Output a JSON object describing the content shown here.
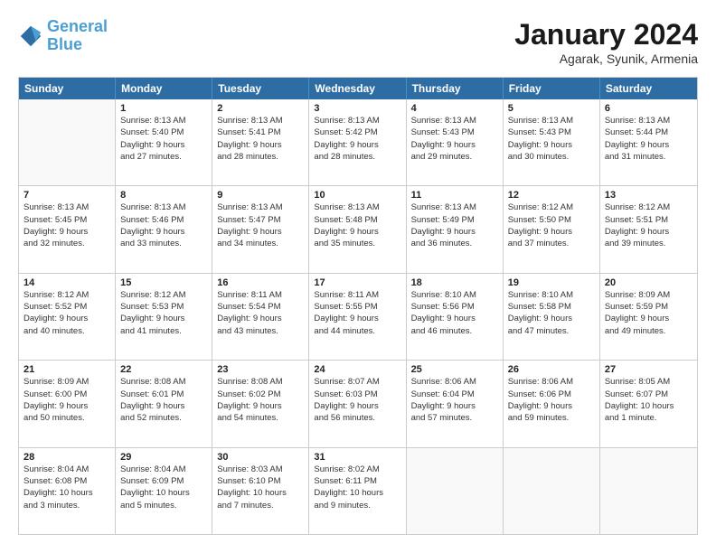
{
  "header": {
    "logo": {
      "line1": "General",
      "line2": "Blue"
    },
    "title": "January 2024",
    "location": "Agarak, Syunik, Armenia"
  },
  "weekdays": [
    "Sunday",
    "Monday",
    "Tuesday",
    "Wednesday",
    "Thursday",
    "Friday",
    "Saturday"
  ],
  "rows": [
    [
      {
        "day": "",
        "info": ""
      },
      {
        "day": "1",
        "info": "Sunrise: 8:13 AM\nSunset: 5:40 PM\nDaylight: 9 hours\nand 27 minutes."
      },
      {
        "day": "2",
        "info": "Sunrise: 8:13 AM\nSunset: 5:41 PM\nDaylight: 9 hours\nand 28 minutes."
      },
      {
        "day": "3",
        "info": "Sunrise: 8:13 AM\nSunset: 5:42 PM\nDaylight: 9 hours\nand 28 minutes."
      },
      {
        "day": "4",
        "info": "Sunrise: 8:13 AM\nSunset: 5:43 PM\nDaylight: 9 hours\nand 29 minutes."
      },
      {
        "day": "5",
        "info": "Sunrise: 8:13 AM\nSunset: 5:43 PM\nDaylight: 9 hours\nand 30 minutes."
      },
      {
        "day": "6",
        "info": "Sunrise: 8:13 AM\nSunset: 5:44 PM\nDaylight: 9 hours\nand 31 minutes."
      }
    ],
    [
      {
        "day": "7",
        "info": "Sunrise: 8:13 AM\nSunset: 5:45 PM\nDaylight: 9 hours\nand 32 minutes."
      },
      {
        "day": "8",
        "info": "Sunrise: 8:13 AM\nSunset: 5:46 PM\nDaylight: 9 hours\nand 33 minutes."
      },
      {
        "day": "9",
        "info": "Sunrise: 8:13 AM\nSunset: 5:47 PM\nDaylight: 9 hours\nand 34 minutes."
      },
      {
        "day": "10",
        "info": "Sunrise: 8:13 AM\nSunset: 5:48 PM\nDaylight: 9 hours\nand 35 minutes."
      },
      {
        "day": "11",
        "info": "Sunrise: 8:13 AM\nSunset: 5:49 PM\nDaylight: 9 hours\nand 36 minutes."
      },
      {
        "day": "12",
        "info": "Sunrise: 8:12 AM\nSunset: 5:50 PM\nDaylight: 9 hours\nand 37 minutes."
      },
      {
        "day": "13",
        "info": "Sunrise: 8:12 AM\nSunset: 5:51 PM\nDaylight: 9 hours\nand 39 minutes."
      }
    ],
    [
      {
        "day": "14",
        "info": "Sunrise: 8:12 AM\nSunset: 5:52 PM\nDaylight: 9 hours\nand 40 minutes."
      },
      {
        "day": "15",
        "info": "Sunrise: 8:12 AM\nSunset: 5:53 PM\nDaylight: 9 hours\nand 41 minutes."
      },
      {
        "day": "16",
        "info": "Sunrise: 8:11 AM\nSunset: 5:54 PM\nDaylight: 9 hours\nand 43 minutes."
      },
      {
        "day": "17",
        "info": "Sunrise: 8:11 AM\nSunset: 5:55 PM\nDaylight: 9 hours\nand 44 minutes."
      },
      {
        "day": "18",
        "info": "Sunrise: 8:10 AM\nSunset: 5:56 PM\nDaylight: 9 hours\nand 46 minutes."
      },
      {
        "day": "19",
        "info": "Sunrise: 8:10 AM\nSunset: 5:58 PM\nDaylight: 9 hours\nand 47 minutes."
      },
      {
        "day": "20",
        "info": "Sunrise: 8:09 AM\nSunset: 5:59 PM\nDaylight: 9 hours\nand 49 minutes."
      }
    ],
    [
      {
        "day": "21",
        "info": "Sunrise: 8:09 AM\nSunset: 6:00 PM\nDaylight: 9 hours\nand 50 minutes."
      },
      {
        "day": "22",
        "info": "Sunrise: 8:08 AM\nSunset: 6:01 PM\nDaylight: 9 hours\nand 52 minutes."
      },
      {
        "day": "23",
        "info": "Sunrise: 8:08 AM\nSunset: 6:02 PM\nDaylight: 9 hours\nand 54 minutes."
      },
      {
        "day": "24",
        "info": "Sunrise: 8:07 AM\nSunset: 6:03 PM\nDaylight: 9 hours\nand 56 minutes."
      },
      {
        "day": "25",
        "info": "Sunrise: 8:06 AM\nSunset: 6:04 PM\nDaylight: 9 hours\nand 57 minutes."
      },
      {
        "day": "26",
        "info": "Sunrise: 8:06 AM\nSunset: 6:06 PM\nDaylight: 9 hours\nand 59 minutes."
      },
      {
        "day": "27",
        "info": "Sunrise: 8:05 AM\nSunset: 6:07 PM\nDaylight: 10 hours\nand 1 minute."
      }
    ],
    [
      {
        "day": "28",
        "info": "Sunrise: 8:04 AM\nSunset: 6:08 PM\nDaylight: 10 hours\nand 3 minutes."
      },
      {
        "day": "29",
        "info": "Sunrise: 8:04 AM\nSunset: 6:09 PM\nDaylight: 10 hours\nand 5 minutes."
      },
      {
        "day": "30",
        "info": "Sunrise: 8:03 AM\nSunset: 6:10 PM\nDaylight: 10 hours\nand 7 minutes."
      },
      {
        "day": "31",
        "info": "Sunrise: 8:02 AM\nSunset: 6:11 PM\nDaylight: 10 hours\nand 9 minutes."
      },
      {
        "day": "",
        "info": ""
      },
      {
        "day": "",
        "info": ""
      },
      {
        "day": "",
        "info": ""
      }
    ]
  ]
}
